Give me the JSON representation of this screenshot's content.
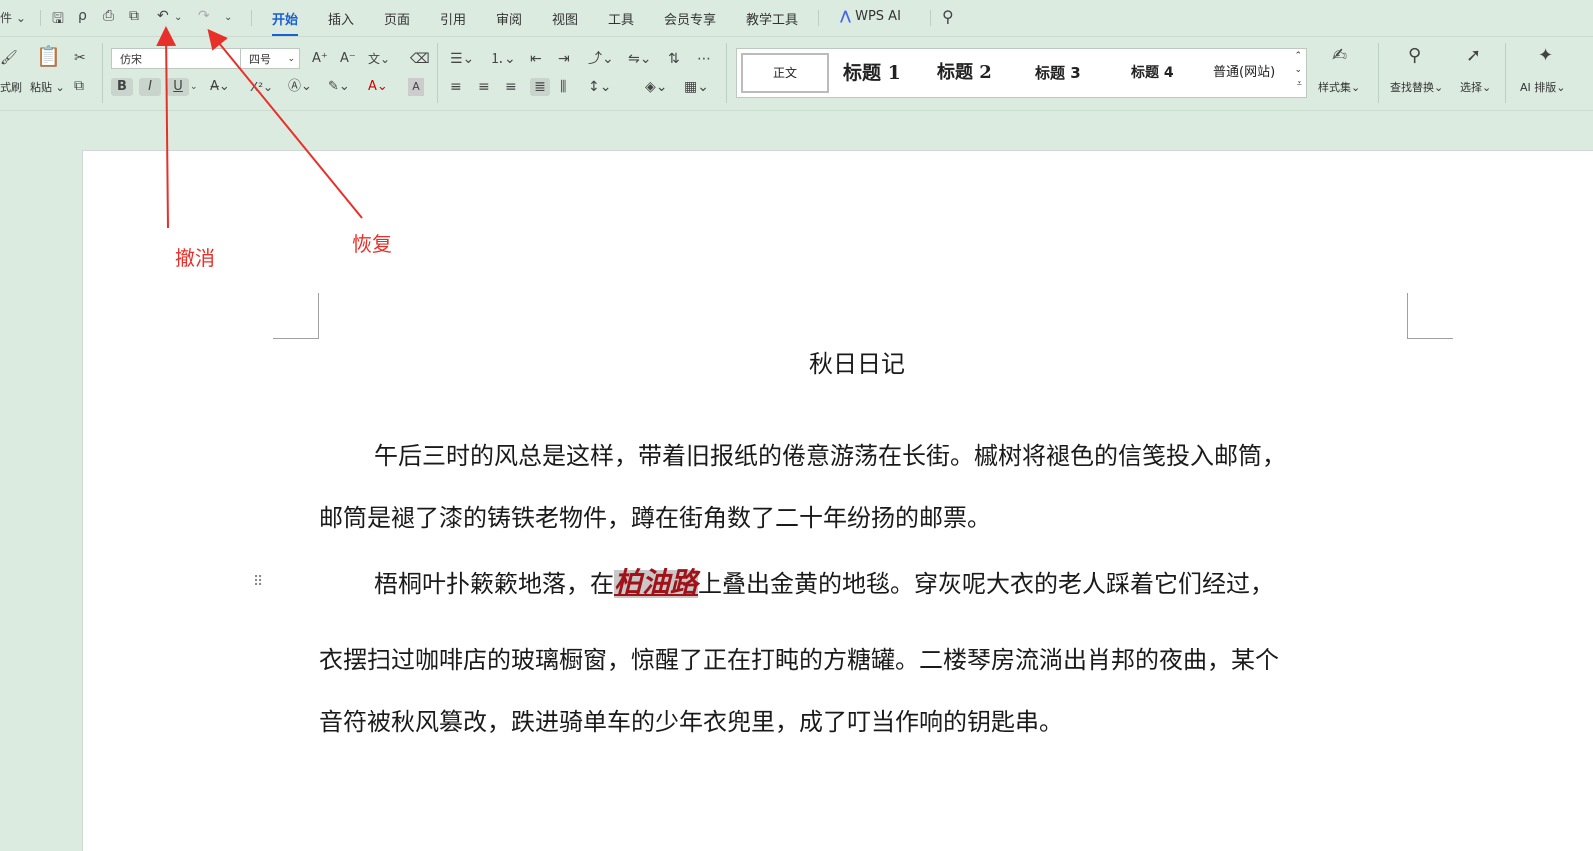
{
  "quick_access": {
    "file_label": "件",
    "tabs": [
      {
        "label": "开始",
        "active": true
      },
      {
        "label": "插入",
        "active": false
      },
      {
        "label": "页面",
        "active": false
      },
      {
        "label": "引用",
        "active": false
      },
      {
        "label": "审阅",
        "active": false
      },
      {
        "label": "视图",
        "active": false
      },
      {
        "label": "工具",
        "active": false
      },
      {
        "label": "会员专享",
        "active": false
      },
      {
        "label": "教学工具",
        "active": false
      }
    ],
    "wps_ai": "WPS AI"
  },
  "ribbon": {
    "format_painter_label": "式刷",
    "paste_label": "粘贴",
    "font_name": "仿宋",
    "font_size": "四号",
    "styles": [
      "正文",
      "标题 1",
      "标题 2",
      "标题 3",
      "标题 4",
      "普通(网站)"
    ],
    "style_set_label": "样式集",
    "find_replace_label": "查找替换",
    "select_label": "选择",
    "ai_layout_label": "AI 排版"
  },
  "document": {
    "title": "秋日日记",
    "p1_line1": "午后三时的风总是这样，带着旧报纸的倦意游荡在长街。槭树将褪色的信笺投入邮筒，",
    "p1_line2": "邮筒是褪了漆的铸铁老物件，蹲在街角数了二十年纷扬的邮票。",
    "p2_before": "梧桐叶扑簌簌地落，在",
    "p2_highlight": "柏油路",
    "p2_after": "上叠出金黄的地毯。穿灰呢大衣的老人踩着它们经过，",
    "p2_line2": "衣摆扫过咖啡店的玻璃橱窗，惊醒了正在打盹的方糖罐。二楼琴房流淌出肖邦的夜曲，某个",
    "p2_line3": "音符被秋风篡改，跌进骑单车的少年衣兜里，成了叮当作响的钥匙串。"
  },
  "annotations": {
    "undo": "撤消",
    "redo": "恢复",
    "color": "#e8302a"
  }
}
